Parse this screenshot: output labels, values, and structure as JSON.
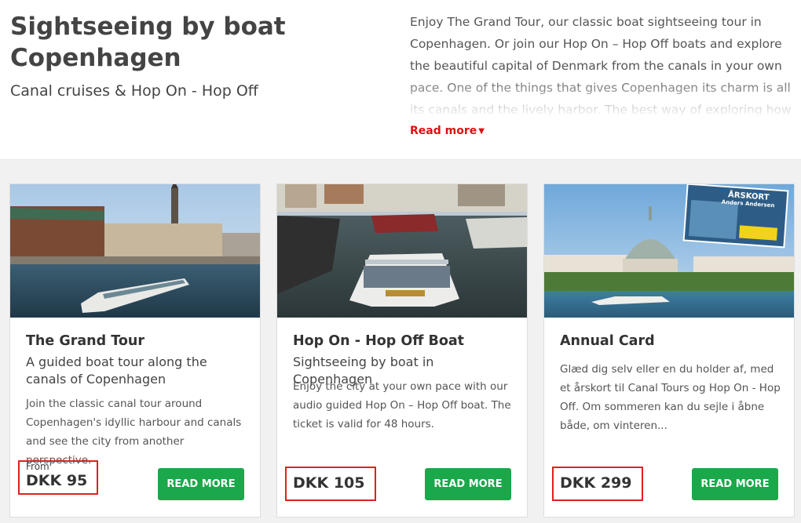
{
  "header": {
    "title": "Sightseeing by boat Copenhagen",
    "subtitle": "Canal cruises & Hop On - Hop Off",
    "intro": "Enjoy The Grand Tour, our classic boat sightseeing tour in Copenhagen. Or join our Hop On – Hop Off boats and explore the beautiful capital of Denmark from the canals in your own pace. One of the things that gives Copenhagen its charm is all its canals and the lively harbor. The best way of exploring how the canals",
    "read_more": "Read more",
    "chevron_icon": "chevron-down-icon"
  },
  "cards": [
    {
      "title": "The Grand Tour",
      "subtitle": "A guided boat tour along the canals of Copenhagen",
      "description": "Join the classic canal tour around Copenhagen's idyllic harbour and canals and see the city from another perspective.",
      "price_prefix": "From",
      "price": "DKK 95",
      "button": "READ MORE"
    },
    {
      "title": "Hop On - Hop Off Boat",
      "subtitle": "Sightseeing by boat in Copenhagen",
      "description": "Enjoy the city at your own pace with our audio guided Hop On – Hop Off boat. The ticket is valid for 48 hours.",
      "price": "DKK 105",
      "button": "READ MORE"
    },
    {
      "title": "Annual Card",
      "description": "Glæd dig selv eller en du holder af, med et årskort til Canal Tours og Hop On - Hop Off. Om sommeren kan du sejle i åbne både, om vinteren...",
      "price": "DKK 299",
      "button": "READ MORE",
      "card_image_label": "ÅRSKORT",
      "card_image_name": "Anders Andersen"
    }
  ],
  "colors": {
    "accent_red": "#d11111",
    "button_green": "#1aa84a",
    "highlight_border": "#e02020",
    "section_bg": "#f1f1f1"
  }
}
